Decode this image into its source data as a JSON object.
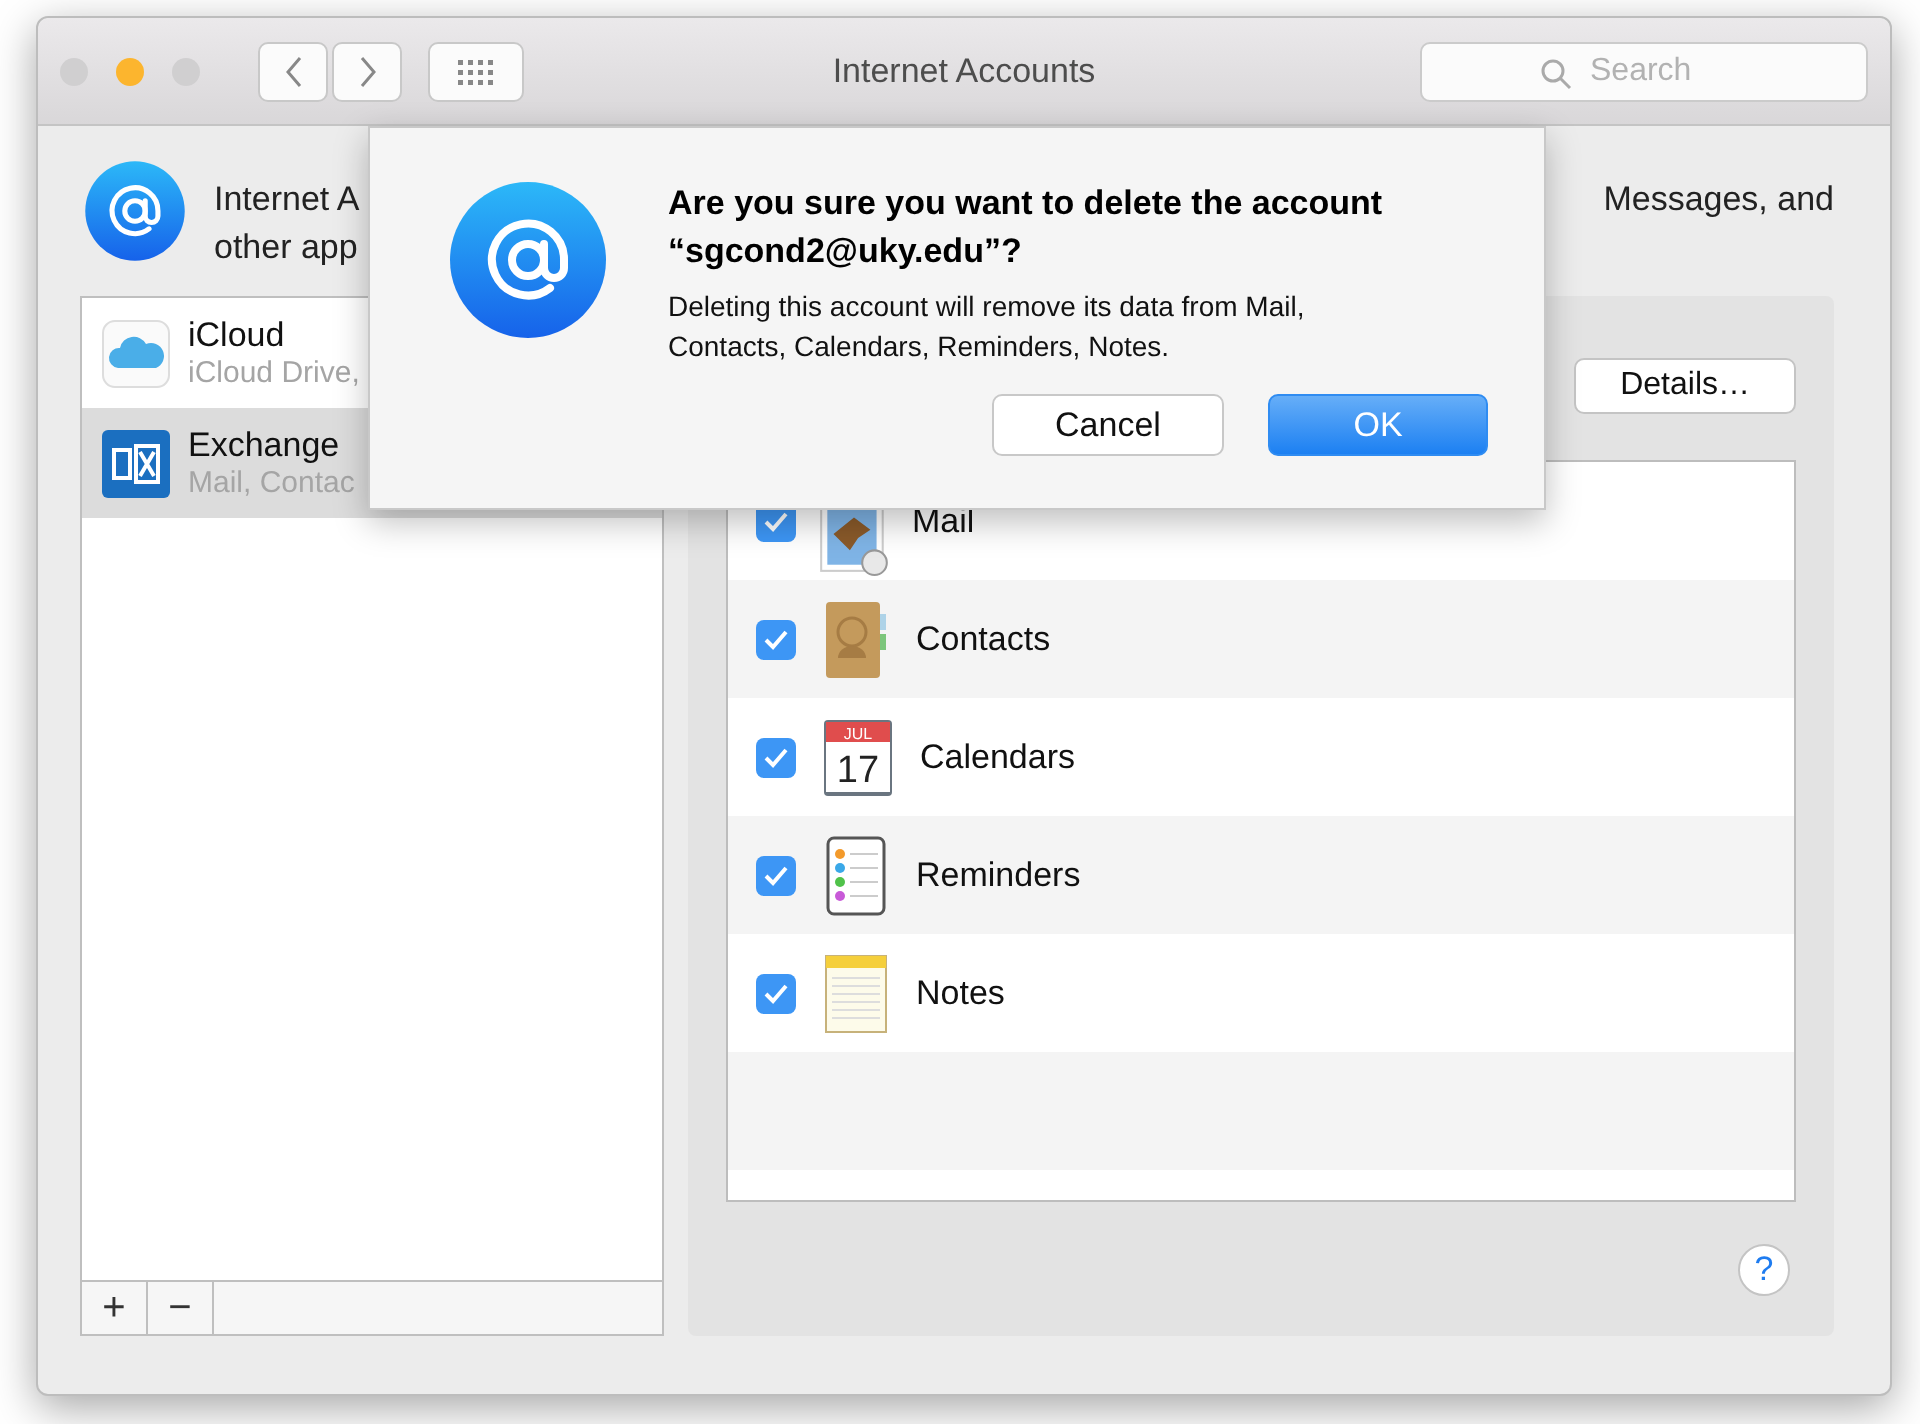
{
  "window": {
    "title": "Internet Accounts",
    "lights": [
      {
        "color": "#d0cfd0"
      },
      {
        "color": "#fcb52e"
      },
      {
        "color": "#d0cfd0"
      }
    ]
  },
  "search": {
    "placeholder": "Search"
  },
  "intro": {
    "left_lines": [
      "Internet A",
      "other app"
    ],
    "right_text": "Messages, and"
  },
  "accounts": [
    {
      "kind": "icloud",
      "name": "iCloud",
      "detail": "iCloud Drive,",
      "selected": false
    },
    {
      "kind": "exchange",
      "name": "Exchange",
      "detail": "Mail, Contac",
      "selected": true
    }
  ],
  "list_buttons": [
    "+",
    "−"
  ],
  "details_button": "Details…",
  "services": [
    {
      "kind": "mail",
      "label": "Mail",
      "checked": true
    },
    {
      "kind": "contacts",
      "label": "Contacts",
      "checked": true
    },
    {
      "kind": "calendar",
      "label": "Calendars",
      "checked": true,
      "month": "JUL",
      "day": "17"
    },
    {
      "kind": "reminders",
      "label": "Reminders",
      "checked": true
    },
    {
      "kind": "notes",
      "label": "Notes",
      "checked": true
    }
  ],
  "help_button": "?",
  "dialog": {
    "title": "Are you sure you want to delete the account “sgcond2@uky.edu”?",
    "message": "Deleting this account will remove its data from Mail, Contacts, Calendars, Reminders, Notes.",
    "buttons": [
      {
        "label": "Cancel",
        "default": false
      },
      {
        "label": "OK",
        "default": true
      }
    ]
  }
}
